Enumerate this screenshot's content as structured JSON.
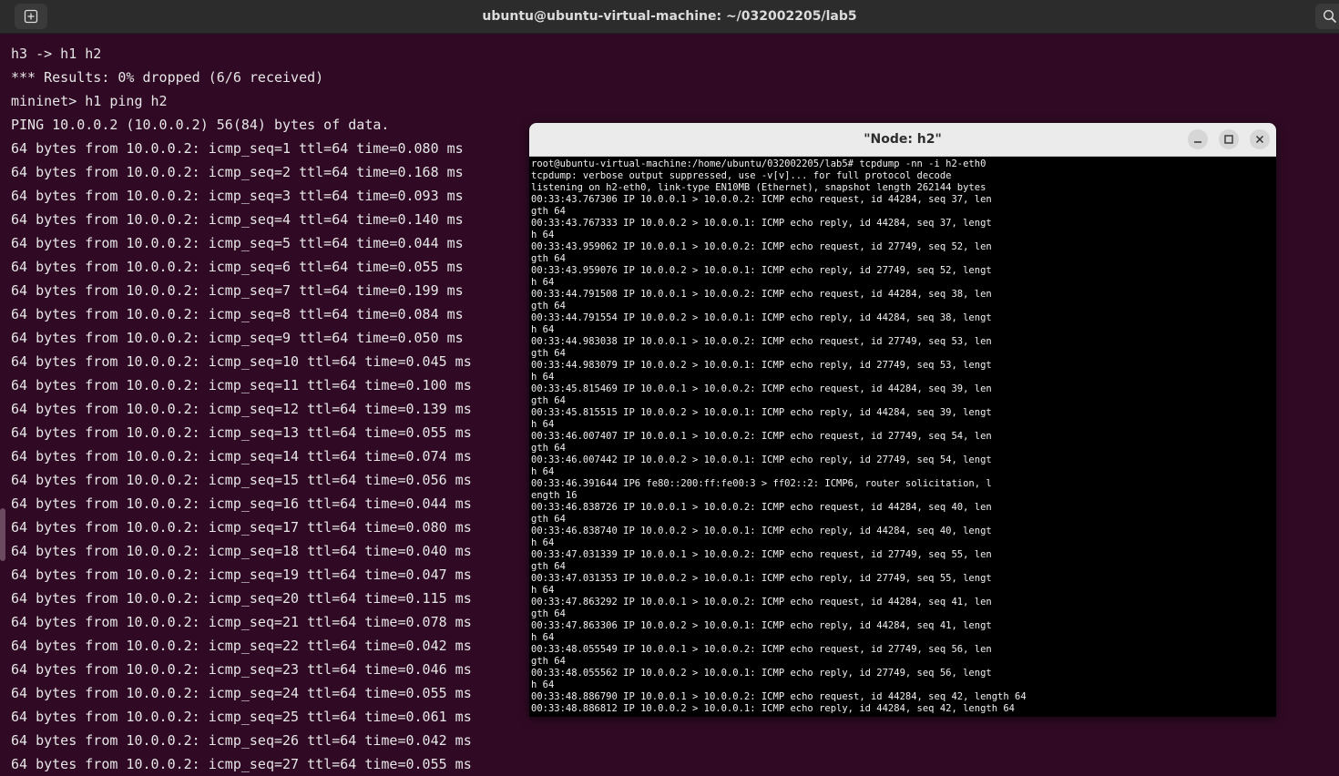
{
  "window": {
    "title": "ubuntu@ubuntu-virtual-machine: ~/032002205/lab5",
    "new_tab_icon": "new-tab-icon",
    "search_icon": "search-icon"
  },
  "main_terminal": {
    "lines": [
      "h3 -> h1 h2",
      "*** Results: 0% dropped (6/6 received)",
      "mininet> h1 ping h2",
      "PING 10.0.0.2 (10.0.0.2) 56(84) bytes of data.",
      "64 bytes from 10.0.0.2: icmp_seq=1 ttl=64 time=0.080 ms",
      "64 bytes from 10.0.0.2: icmp_seq=2 ttl=64 time=0.168 ms",
      "64 bytes from 10.0.0.2: icmp_seq=3 ttl=64 time=0.093 ms",
      "64 bytes from 10.0.0.2: icmp_seq=4 ttl=64 time=0.140 ms",
      "64 bytes from 10.0.0.2: icmp_seq=5 ttl=64 time=0.044 ms",
      "64 bytes from 10.0.0.2: icmp_seq=6 ttl=64 time=0.055 ms",
      "64 bytes from 10.0.0.2: icmp_seq=7 ttl=64 time=0.199 ms",
      "64 bytes from 10.0.0.2: icmp_seq=8 ttl=64 time=0.084 ms",
      "64 bytes from 10.0.0.2: icmp_seq=9 ttl=64 time=0.050 ms",
      "64 bytes from 10.0.0.2: icmp_seq=10 ttl=64 time=0.045 ms",
      "64 bytes from 10.0.0.2: icmp_seq=11 ttl=64 time=0.100 ms",
      "64 bytes from 10.0.0.2: icmp_seq=12 ttl=64 time=0.139 ms",
      "64 bytes from 10.0.0.2: icmp_seq=13 ttl=64 time=0.055 ms",
      "64 bytes from 10.0.0.2: icmp_seq=14 ttl=64 time=0.074 ms",
      "64 bytes from 10.0.0.2: icmp_seq=15 ttl=64 time=0.056 ms",
      "64 bytes from 10.0.0.2: icmp_seq=16 ttl=64 time=0.044 ms",
      "64 bytes from 10.0.0.2: icmp_seq=17 ttl=64 time=0.080 ms",
      "64 bytes from 10.0.0.2: icmp_seq=18 ttl=64 time=0.040 ms",
      "64 bytes from 10.0.0.2: icmp_seq=19 ttl=64 time=0.047 ms",
      "64 bytes from 10.0.0.2: icmp_seq=20 ttl=64 time=0.115 ms",
      "64 bytes from 10.0.0.2: icmp_seq=21 ttl=64 time=0.078 ms",
      "64 bytes from 10.0.0.2: icmp_seq=22 ttl=64 time=0.042 ms",
      "64 bytes from 10.0.0.2: icmp_seq=23 ttl=64 time=0.046 ms",
      "64 bytes from 10.0.0.2: icmp_seq=24 ttl=64 time=0.055 ms",
      "64 bytes from 10.0.0.2: icmp_seq=25 ttl=64 time=0.061 ms",
      "64 bytes from 10.0.0.2: icmp_seq=26 ttl=64 time=0.042 ms",
      "64 bytes from 10.0.0.2: icmp_seq=27 ttl=64 time=0.055 ms"
    ]
  },
  "node_window": {
    "title": "\"Node: h2\"",
    "minimize_icon": "minimize-icon",
    "maximize_icon": "maximize-icon",
    "close_icon": "close-icon",
    "lines": [
      "root@ubuntu-virtual-machine:/home/ubuntu/032002205/lab5# tcpdump -nn -i h2-eth0",
      "tcpdump: verbose output suppressed, use -v[v]... for full protocol decode",
      "listening on h2-eth0, link-type EN10MB (Ethernet), snapshot length 262144 bytes",
      "00:33:43.767306 IP 10.0.0.1 > 10.0.0.2: ICMP echo request, id 44284, seq 37, len",
      "gth 64",
      "00:33:43.767333 IP 10.0.0.2 > 10.0.0.1: ICMP echo reply, id 44284, seq 37, lengt",
      "h 64",
      "00:33:43.959062 IP 10.0.0.1 > 10.0.0.2: ICMP echo request, id 27749, seq 52, len",
      "gth 64",
      "00:33:43.959076 IP 10.0.0.2 > 10.0.0.1: ICMP echo reply, id 27749, seq 52, lengt",
      "h 64",
      "00:33:44.791508 IP 10.0.0.1 > 10.0.0.2: ICMP echo request, id 44284, seq 38, len",
      "gth 64",
      "00:33:44.791554 IP 10.0.0.2 > 10.0.0.1: ICMP echo reply, id 44284, seq 38, lengt",
      "h 64",
      "00:33:44.983038 IP 10.0.0.1 > 10.0.0.2: ICMP echo request, id 27749, seq 53, len",
      "gth 64",
      "00:33:44.983079 IP 10.0.0.2 > 10.0.0.1: ICMP echo reply, id 27749, seq 53, lengt",
      "h 64",
      "00:33:45.815469 IP 10.0.0.1 > 10.0.0.2: ICMP echo request, id 44284, seq 39, len",
      "gth 64",
      "00:33:45.815515 IP 10.0.0.2 > 10.0.0.1: ICMP echo reply, id 44284, seq 39, lengt",
      "h 64",
      "00:33:46.007407 IP 10.0.0.1 > 10.0.0.2: ICMP echo request, id 27749, seq 54, len",
      "gth 64",
      "00:33:46.007442 IP 10.0.0.2 > 10.0.0.1: ICMP echo reply, id 27749, seq 54, lengt",
      "h 64",
      "00:33:46.391644 IP6 fe80::200:ff:fe00:3 > ff02::2: ICMP6, router solicitation, l",
      "ength 16",
      "00:33:46.838726 IP 10.0.0.1 > 10.0.0.2: ICMP echo request, id 44284, seq 40, len",
      "gth 64",
      "00:33:46.838740 IP 10.0.0.2 > 10.0.0.1: ICMP echo reply, id 44284, seq 40, lengt",
      "h 64",
      "00:33:47.031339 IP 10.0.0.1 > 10.0.0.2: ICMP echo request, id 27749, seq 55, len",
      "gth 64",
      "00:33:47.031353 IP 10.0.0.2 > 10.0.0.1: ICMP echo reply, id 27749, seq 55, lengt",
      "h 64",
      "00:33:47.863292 IP 10.0.0.1 > 10.0.0.2: ICMP echo request, id 44284, seq 41, len",
      "gth 64",
      "00:33:47.863306 IP 10.0.0.2 > 10.0.0.1: ICMP echo reply, id 44284, seq 41, lengt",
      "h 64",
      "00:33:48.055549 IP 10.0.0.1 > 10.0.0.2: ICMP echo request, id 27749, seq 56, len",
      "gth 64",
      "00:33:48.055562 IP 10.0.0.2 > 10.0.0.1: ICMP echo reply, id 27749, seq 56, lengt",
      "h 64",
      "00:33:48.886790 IP 10.0.0.1 > 10.0.0.2: ICMP echo request, id 44284, seq 42, length 64",
      "00:33:48.886812 IP 10.0.0.2 > 10.0.0.1: ICMP echo reply, id 44284, seq 42, length 64"
    ]
  },
  "colors": {
    "terminal_bg": "#300a24",
    "terminal_fg": "#e6e6e6",
    "titlebar_bg": "#2c2c2c",
    "xterm_bg": "#000000"
  }
}
